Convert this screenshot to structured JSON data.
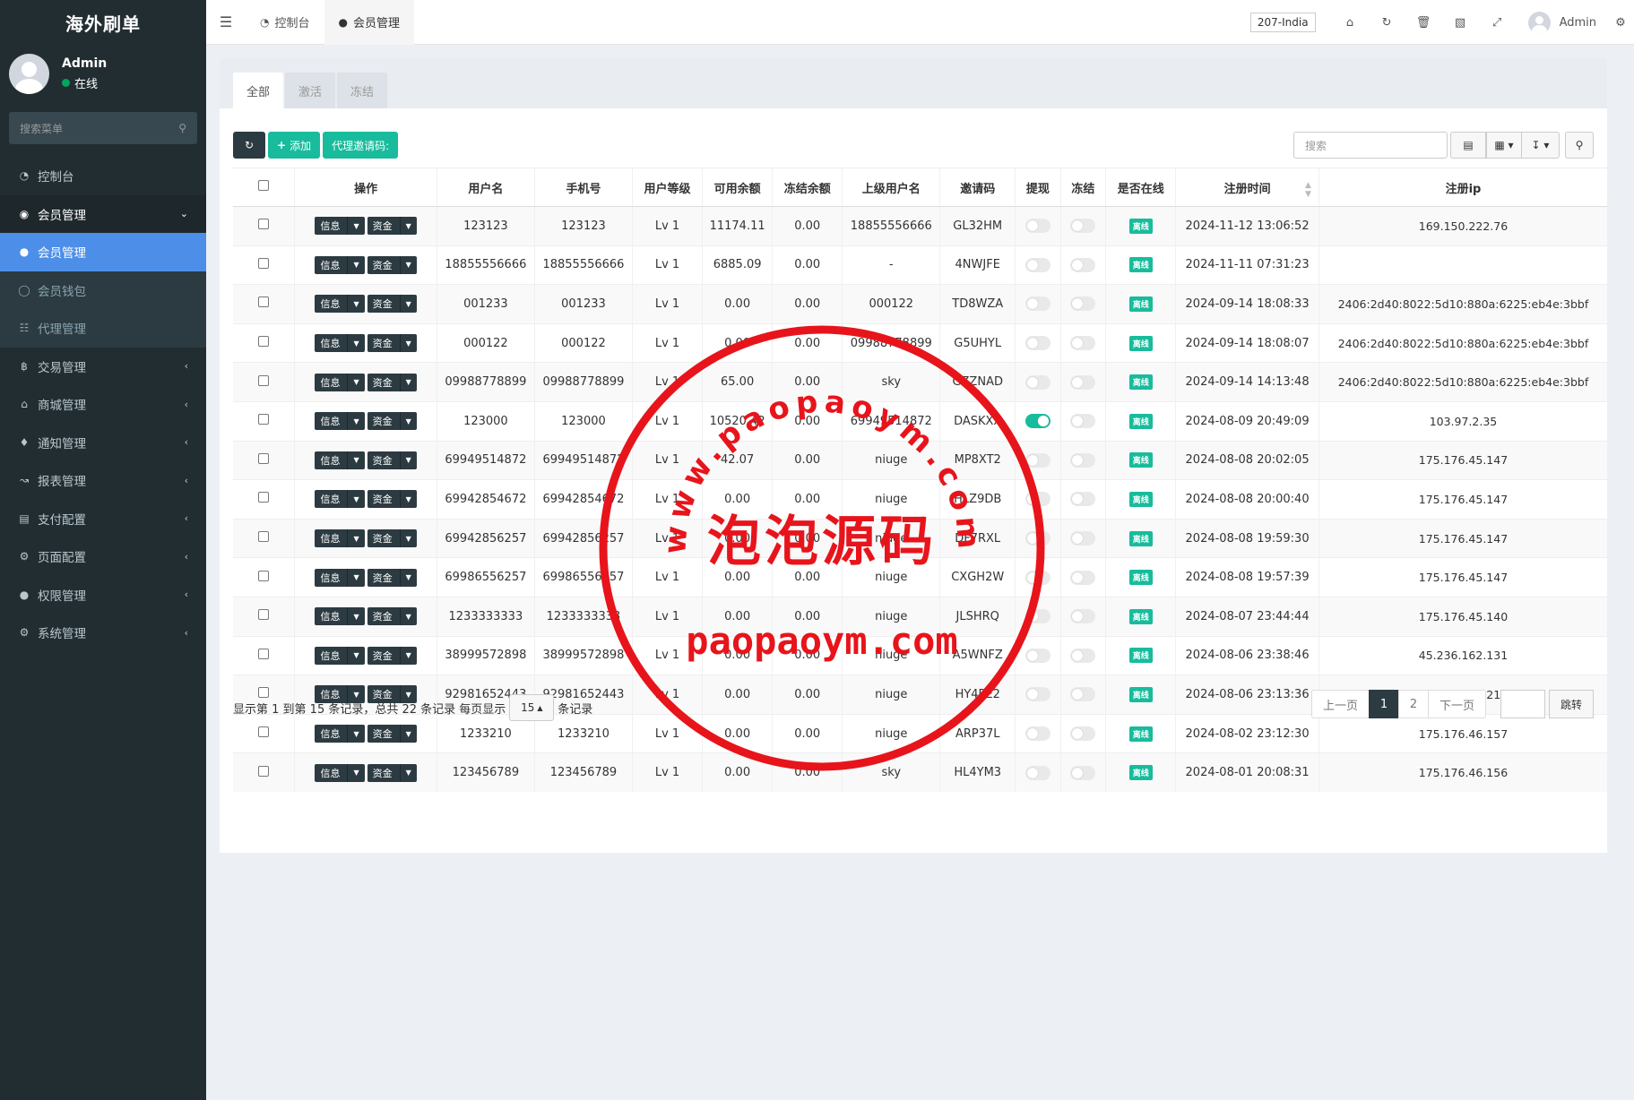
{
  "app": {
    "logo": "海外刷单"
  },
  "user": {
    "name": "Admin",
    "status": "在线"
  },
  "sidebar": {
    "search_placeholder": "搜索菜单",
    "items": [
      {
        "label": "控制台",
        "icon": "dashboard-icon"
      },
      {
        "label": "会员管理",
        "icon": "user-circle-icon"
      },
      {
        "label": "会员管理",
        "icon": "user-icon"
      },
      {
        "label": "会员钱包",
        "icon": "wallet-icon"
      },
      {
        "label": "代理管理",
        "icon": "sitemap-icon"
      },
      {
        "label": "交易管理",
        "icon": "bitcoin-icon"
      },
      {
        "label": "商城管理",
        "icon": "home-icon"
      },
      {
        "label": "通知管理",
        "icon": "bell-icon"
      },
      {
        "label": "报表管理",
        "icon": "line-chart-icon"
      },
      {
        "label": "支付配置",
        "icon": "credit-card-icon"
      },
      {
        "label": "页面配置",
        "icon": "gear-icon"
      },
      {
        "label": "权限管理",
        "icon": "group-icon"
      },
      {
        "label": "系统管理",
        "icon": "cogs-icon"
      }
    ]
  },
  "topbar": {
    "tabs": [
      {
        "label": "控制台"
      },
      {
        "label": "会员管理"
      }
    ],
    "region": "207-India",
    "user_name": "Admin"
  },
  "content": {
    "tabs": [
      "全部",
      "激活",
      "冻结"
    ],
    "add_label": "添加",
    "invite_label": "代理邀请码:",
    "search_placeholder": "搜索"
  },
  "table": {
    "headers": [
      "操作",
      "用户名",
      "手机号",
      "用户等级",
      "可用余额",
      "冻结余额",
      "上级用户名",
      "邀请码",
      "提现",
      "冻结",
      "是否在线",
      "注册时间",
      "注册ip"
    ],
    "info_label": "信息",
    "fund_label": "资金",
    "rows": [
      {
        "username": "123123",
        "phone": "123123",
        "level": "Lv 1",
        "balance": "11174.11",
        "frozen": "0.00",
        "parent": "18855556666",
        "code": "GL32HM",
        "withdraw": false,
        "freeze": false,
        "online": "离线",
        "time": "2024-11-12 13:06:52",
        "ip": "169.150.222.76"
      },
      {
        "username": "18855556666",
        "phone": "18855556666",
        "level": "Lv 1",
        "balance": "6885.09",
        "frozen": "0.00",
        "parent": "-",
        "code": "4NWJFE",
        "withdraw": false,
        "freeze": false,
        "online": "离线",
        "time": "2024-11-11 07:31:23",
        "ip": ""
      },
      {
        "username": "001233",
        "phone": "001233",
        "level": "Lv 1",
        "balance": "0.00",
        "frozen": "0.00",
        "parent": "000122",
        "code": "TD8WZA",
        "withdraw": false,
        "freeze": false,
        "online": "离线",
        "time": "2024-09-14 18:08:33",
        "ip": "2406:2d40:8022:5d10:880a:6225:eb4e:3bbf"
      },
      {
        "username": "000122",
        "phone": "000122",
        "level": "Lv 1",
        "balance": "0.00",
        "frozen": "0.00",
        "parent": "09988778899",
        "code": "G5UHYL",
        "withdraw": false,
        "freeze": false,
        "online": "离线",
        "time": "2024-09-14 18:08:07",
        "ip": "2406:2d40:8022:5d10:880a:6225:eb4e:3bbf"
      },
      {
        "username": "09988778899",
        "phone": "09988778899",
        "level": "Lv 1",
        "balance": "65.00",
        "frozen": "0.00",
        "parent": "sky",
        "code": "GZZNAD",
        "withdraw": false,
        "freeze": false,
        "online": "离线",
        "time": "2024-09-14 14:13:48",
        "ip": "2406:2d40:8022:5d10:880a:6225:eb4e:3bbf"
      },
      {
        "username": "123000",
        "phone": "123000",
        "level": "Lv 1",
        "balance": "10520.42",
        "frozen": "0.00",
        "parent": "69949514872",
        "code": "DASKXX",
        "withdraw": true,
        "freeze": false,
        "online": "离线",
        "time": "2024-08-09 20:49:09",
        "ip": "103.97.2.35"
      },
      {
        "username": "69949514872",
        "phone": "69949514872",
        "level": "Lv 1",
        "balance": "42.07",
        "frozen": "0.00",
        "parent": "niuge",
        "code": "MP8XT2",
        "withdraw": false,
        "freeze": false,
        "online": "离线",
        "time": "2024-08-08 20:02:05",
        "ip": "175.176.45.147"
      },
      {
        "username": "69942854672",
        "phone": "69942854672",
        "level": "Lv 1",
        "balance": "0.00",
        "frozen": "0.00",
        "parent": "niuge",
        "code": "HLZ9DB",
        "withdraw": false,
        "freeze": false,
        "online": "离线",
        "time": "2024-08-08 20:00:40",
        "ip": "175.176.45.147"
      },
      {
        "username": "69942856257",
        "phone": "69942856257",
        "level": "Lv 1",
        "balance": "0.00",
        "frozen": "0.00",
        "parent": "niuge",
        "code": "DF7RXL",
        "withdraw": false,
        "freeze": false,
        "online": "离线",
        "time": "2024-08-08 19:59:30",
        "ip": "175.176.45.147"
      },
      {
        "username": "69986556257",
        "phone": "69986556257",
        "level": "Lv 1",
        "balance": "0.00",
        "frozen": "0.00",
        "parent": "niuge",
        "code": "CXGH2W",
        "withdraw": false,
        "freeze": false,
        "online": "离线",
        "time": "2024-08-08 19:57:39",
        "ip": "175.176.45.147"
      },
      {
        "username": "1233333333",
        "phone": "1233333333",
        "level": "Lv 1",
        "balance": "0.00",
        "frozen": "0.00",
        "parent": "niuge",
        "code": "JLSHRQ",
        "withdraw": false,
        "freeze": false,
        "online": "离线",
        "time": "2024-08-07 23:44:44",
        "ip": "175.176.45.140"
      },
      {
        "username": "38999572898",
        "phone": "38999572898",
        "level": "Lv 1",
        "balance": "0.00",
        "frozen": "0.00",
        "parent": "niuge",
        "code": "A5WNFZ",
        "withdraw": false,
        "freeze": false,
        "online": "离线",
        "time": "2024-08-06 23:38:46",
        "ip": "45.236.162.131"
      },
      {
        "username": "92981652443",
        "phone": "92981652443",
        "level": "Lv 1",
        "balance": "0.00",
        "frozen": "0.00",
        "parent": "niuge",
        "code": "HY4PE2",
        "withdraw": false,
        "freeze": false,
        "online": "离线",
        "time": "2024-08-06 23:13:36",
        "ip": "201.75.43.21"
      },
      {
        "username": "1233210",
        "phone": "1233210",
        "level": "Lv 1",
        "balance": "0.00",
        "frozen": "0.00",
        "parent": "niuge",
        "code": "ARP37L",
        "withdraw": false,
        "freeze": false,
        "online": "离线",
        "time": "2024-08-02 23:12:30",
        "ip": "175.176.46.157"
      },
      {
        "username": "123456789",
        "phone": "123456789",
        "level": "Lv 1",
        "balance": "0.00",
        "frozen": "0.00",
        "parent": "sky",
        "code": "HL4YM3",
        "withdraw": false,
        "freeze": false,
        "online": "离线",
        "time": "2024-08-01 20:08:31",
        "ip": "175.176.46.156"
      }
    ]
  },
  "pagination": {
    "info": "显示第 1 到第 15 条记录，总共 22 条记录 每页显示",
    "per_page": "15",
    "suffix": "条记录",
    "prev": "上一页",
    "pages": [
      "1",
      "2"
    ],
    "next": "下一页",
    "jump": "跳转"
  },
  "watermark": {
    "arc_text": "www.paopaoym.com",
    "center_text": "泡泡源码",
    "bottom_text": "paopaoym.com",
    "color": "#e8141b"
  }
}
